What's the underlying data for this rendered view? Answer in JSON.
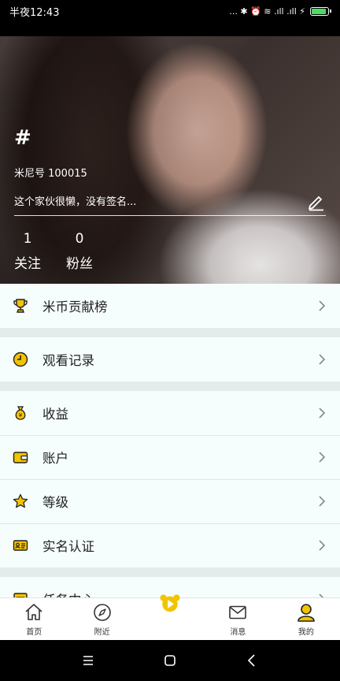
{
  "status_bar": {
    "time": "半夜12:43",
    "signal_text": "... ✱ ⏰ ≋ .ıll .ıll ⚡",
    "battery_level": 0.9,
    "battery_color": "#4cd964"
  },
  "profile": {
    "level_icon": "hash-level-icon",
    "uid": "米尼号 100015",
    "signature": "这个家伙很懒，没有签名...",
    "stats": [
      {
        "value": "1",
        "label": "关注"
      },
      {
        "value": "0",
        "label": "粉丝"
      }
    ]
  },
  "menu": {
    "groups": [
      [
        {
          "label": "米币贡献榜",
          "icon": "trophy-icon"
        }
      ],
      [
        {
          "label": "观看记录",
          "icon": "clock-icon"
        }
      ],
      [
        {
          "label": "收益",
          "icon": "money-bag-icon"
        },
        {
          "label": "账户",
          "icon": "wallet-icon"
        },
        {
          "label": "等级",
          "icon": "star-icon"
        },
        {
          "label": "实名认证",
          "icon": "id-card-icon"
        }
      ],
      [
        {
          "label": "任务中心",
          "icon": "task-icon"
        }
      ]
    ],
    "accent_color": "#f2c400"
  },
  "bottom_nav": {
    "items": [
      {
        "label": "首页",
        "icon": "home-icon"
      },
      {
        "label": "附近",
        "icon": "compass-icon"
      },
      {
        "label": "",
        "icon": "play-bear-icon"
      },
      {
        "label": "消息",
        "icon": "mail-icon"
      },
      {
        "label": "我的",
        "icon": "profile-icon"
      }
    ]
  },
  "system_nav": {
    "buttons": [
      "menu-icon",
      "home-square-icon",
      "back-icon"
    ]
  }
}
